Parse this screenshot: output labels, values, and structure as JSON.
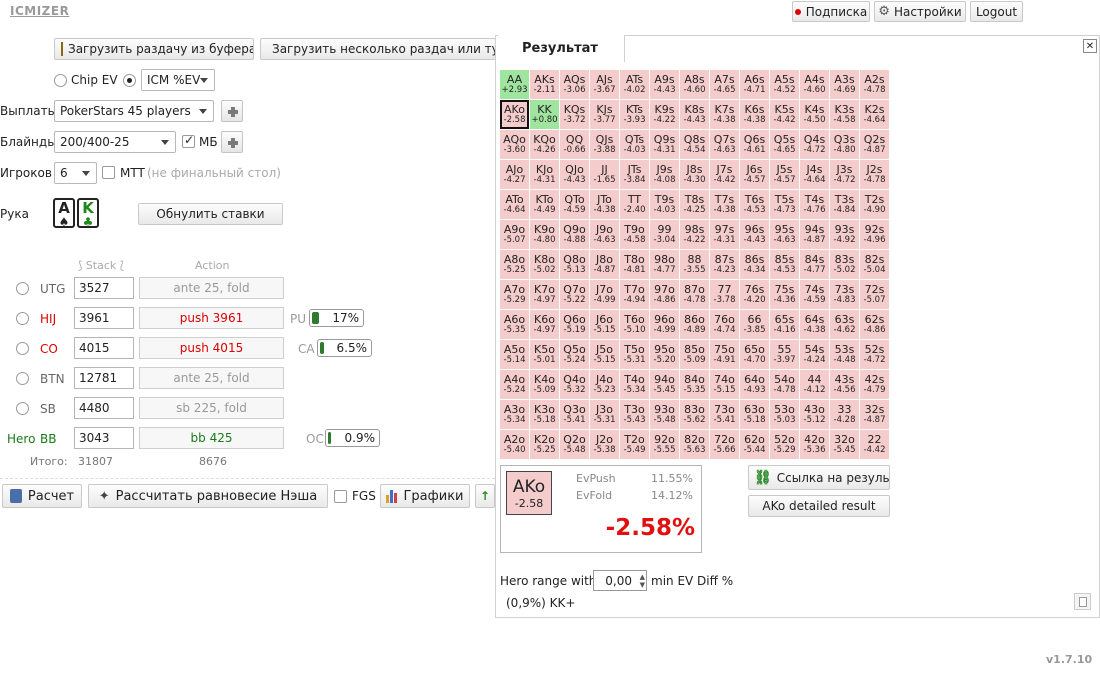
{
  "app": {
    "logo": "ICMIZER",
    "version": "v1.7.10"
  },
  "topbar": {
    "subscribe": "Подписка",
    "settings": "Настройки",
    "logout": "Logout"
  },
  "load": {
    "from_clipboard": "Загрузить раздачу из буфера",
    "multiple": "Загрузить несколько раздач или тур"
  },
  "mode": {
    "chip_ev": "Chip EV",
    "icm_ev": "ICM %EV"
  },
  "payouts": {
    "label": "Выплаты",
    "value": "PokerStars 45 players"
  },
  "blinds": {
    "label": "Блайнды",
    "value": "200/400-25",
    "mb": "МБ"
  },
  "players": {
    "label": "Игроков",
    "value": "6",
    "mtt": "MTT",
    "final_note": "(не финальный стол)"
  },
  "hand": {
    "label": "Рука",
    "card1": {
      "rank": "A",
      "suit": "♠"
    },
    "card2": {
      "rank": "K",
      "suit": "♣"
    },
    "reset": "Обнулить ставки"
  },
  "table": {
    "stack_header": "Stack",
    "action_header": "Action",
    "rows": [
      {
        "pos": "UTG",
        "stack": "3527",
        "action": "ante 25, fold"
      },
      {
        "pos": "HIJ",
        "stack": "3961",
        "action": "push 3961",
        "meter_label": "PU",
        "meter_value": "17%"
      },
      {
        "pos": "CO",
        "stack": "4015",
        "action": "push 4015",
        "meter_label": "CA",
        "meter_value": "6.5%"
      },
      {
        "pos": "BTN",
        "stack": "12781",
        "action": "ante 25, fold"
      },
      {
        "pos": "SB",
        "stack": "4480",
        "action": "sb 225, fold"
      },
      {
        "pos": "BB",
        "hero_tag": "Hero",
        "stack": "3043",
        "action": "bb 425",
        "meter_label": "OC",
        "meter_value": "0.9%"
      }
    ],
    "total_label": "Итого:",
    "total_stack": "31807",
    "total_action": "8676"
  },
  "actions": {
    "calc": "Расчет",
    "nash": "Рассчитать равновесие Нэша",
    "fgs": "FGS",
    "charts": "Графики"
  },
  "result": {
    "tab": "Результат",
    "grid": [
      [
        "AA|+2.93",
        "AKs|-2.11",
        "AQs|-3.06",
        "AJs|-3.67",
        "ATs|-4.02",
        "A9s|-4.43",
        "A8s|-4.60",
        "A7s|-4.65",
        "A6s|-4.71",
        "A5s|-4.52",
        "A4s|-4.60",
        "A3s|-4.69",
        "A2s|-4.78"
      ],
      [
        "AKo|-2.58",
        "KK|+0.80",
        "KQs|-3.72",
        "KJs|-3.77",
        "KTs|-3.93",
        "K9s|-4.22",
        "K8s|-4.43",
        "K7s|-4.38",
        "K6s|-4.38",
        "K5s|-4.42",
        "K4s|-4.50",
        "K3s|-4.58",
        "K2s|-4.64"
      ],
      [
        "AQo|-3.60",
        "KQo|-4.26",
        "QQ|-0.66",
        "QJs|-3.88",
        "QTs|-4.03",
        "Q9s|-4.31",
        "Q8s|-4.54",
        "Q7s|-4.63",
        "Q6s|-4.61",
        "Q5s|-4.65",
        "Q4s|-4.72",
        "Q3s|-4.80",
        "Q2s|-4.87"
      ],
      [
        "AJo|-4.27",
        "KJo|-4.31",
        "QJo|-4.43",
        "JJ|-1.65",
        "JTs|-3.84",
        "J9s|-4.08",
        "J8s|-4.30",
        "J7s|-4.42",
        "J6s|-4.57",
        "J5s|-4.57",
        "J4s|-4.64",
        "J3s|-4.72",
        "J2s|-4.78"
      ],
      [
        "ATo|-4.64",
        "KTo|-4.49",
        "QTo|-4.59",
        "JTo|-4.38",
        "TT|-2.40",
        "T9s|-4.03",
        "T8s|-4.25",
        "T7s|-4.38",
        "T6s|-4.53",
        "T5s|-4.73",
        "T4s|-4.76",
        "T3s|-4.84",
        "T2s|-4.90"
      ],
      [
        "A9o|-5.07",
        "K9o|-4.80",
        "Q9o|-4.88",
        "J9o|-4.63",
        "T9o|-4.58",
        "99|-3.04",
        "98s|-4.22",
        "97s|-4.31",
        "96s|-4.43",
        "95s|-4.63",
        "94s|-4.87",
        "93s|-4.92",
        "92s|-4.96"
      ],
      [
        "A8o|-5.25",
        "K8o|-5.02",
        "Q8o|-5.13",
        "J8o|-4.87",
        "T8o|-4.81",
        "98o|-4.77",
        "88|-3.55",
        "87s|-4.23",
        "86s|-4.34",
        "85s|-4.53",
        "84s|-4.77",
        "83s|-5.02",
        "82s|-5.04"
      ],
      [
        "A7o|-5.29",
        "K7o|-4.97",
        "Q7o|-5.22",
        "J7o|-4.99",
        "T7o|-4.94",
        "97o|-4.86",
        "87o|-4.78",
        "77|-3.78",
        "76s|-4.20",
        "75s|-4.36",
        "74s|-4.59",
        "73s|-4.83",
        "72s|-5.07"
      ],
      [
        "A6o|-5.35",
        "K6o|-4.97",
        "Q6o|-5.19",
        "J6o|-5.15",
        "T6o|-5.10",
        "96o|-4.99",
        "86o|-4.89",
        "76o|-4.74",
        "66|-3.85",
        "65s|-4.16",
        "64s|-4.38",
        "63s|-4.62",
        "62s|-4.86"
      ],
      [
        "A5o|-5.14",
        "K5o|-5.01",
        "Q5o|-5.24",
        "J5o|-5.15",
        "T5o|-5.31",
        "95o|-5.20",
        "85o|-5.09",
        "75o|-4.91",
        "65o|-4.70",
        "55|-3.97",
        "54s|-4.24",
        "53s|-4.48",
        "52s|-4.72"
      ],
      [
        "A4o|-5.24",
        "K4o|-5.09",
        "Q4o|-5.32",
        "J4o|-5.23",
        "T4o|-5.34",
        "94o|-5.45",
        "84o|-5.35",
        "74o|-5.15",
        "64o|-4.93",
        "54o|-4.78",
        "44|-4.12",
        "43s|-4.56",
        "42s|-4.79"
      ],
      [
        "A3o|-5.34",
        "K3o|-5.18",
        "Q3o|-5.41",
        "J3o|-5.31",
        "T3o|-5.43",
        "93o|-5.48",
        "83o|-5.62",
        "73o|-5.41",
        "63o|-5.18",
        "53o|-5.03",
        "43o|-5.12",
        "33|-4.28",
        "32s|-4.87"
      ],
      [
        "A2o|-5.40",
        "K2o|-5.25",
        "Q2o|-5.48",
        "J2o|-5.38",
        "T2o|-5.49",
        "92o|-5.55",
        "82o|-5.63",
        "72o|-5.66",
        "62o|-5.44",
        "52o|-5.29",
        "42o|-5.36",
        "32o|-5.45",
        "22|-4.42"
      ]
    ],
    "detail": {
      "hand": "AKo",
      "hand_ev": "-2.58",
      "ev_push_label": "EvPush",
      "ev_push": "11.55%",
      "ev_fold_label": "EvFold",
      "ev_fold": "14.12%",
      "diff": "-2.58%"
    },
    "link_btn": "Ссылка на результат",
    "detailed_btn": "AKo detailed result",
    "hero_range_label": "Hero range with",
    "hero_range_value": "0,00",
    "hero_range_suffix": "min EV Diff %",
    "range_text": "(0,9%) KK+"
  }
}
